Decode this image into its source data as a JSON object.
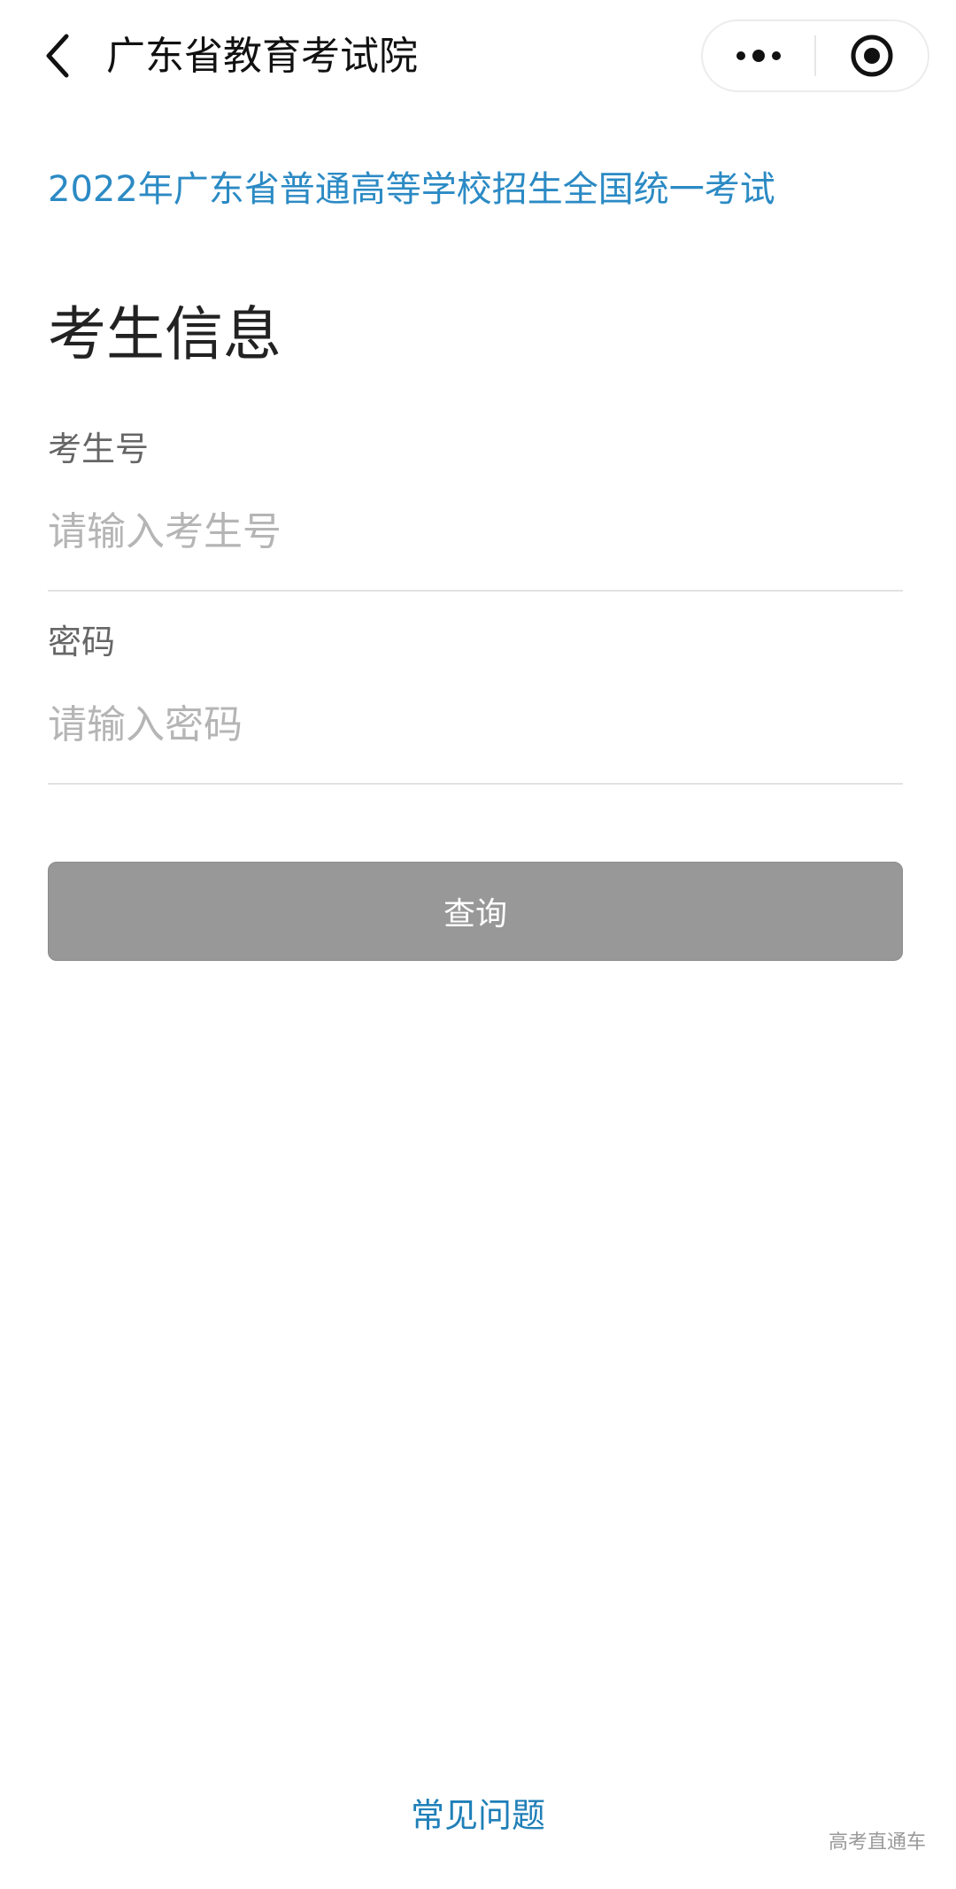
{
  "navbar": {
    "title": "广东省教育考试院",
    "back_icon": "chevron-left-icon",
    "more_icon": "more-dots-icon",
    "close_icon": "target-circle-icon"
  },
  "content": {
    "exam_title": "2022年广东省普通高等学校招生全国统一考试",
    "section_title": "考生信息",
    "exam_title_color": "#2b8ac4"
  },
  "form": {
    "candidate_number": {
      "label": "考生号",
      "value": "",
      "placeholder": "请输入考生号"
    },
    "password": {
      "label": "密码",
      "value": "",
      "placeholder": "请输入密码"
    },
    "submit_label": "查询",
    "submit_color": "#989898"
  },
  "footer": {
    "faq_label": "常见问题",
    "watermark": "高考直通车"
  }
}
